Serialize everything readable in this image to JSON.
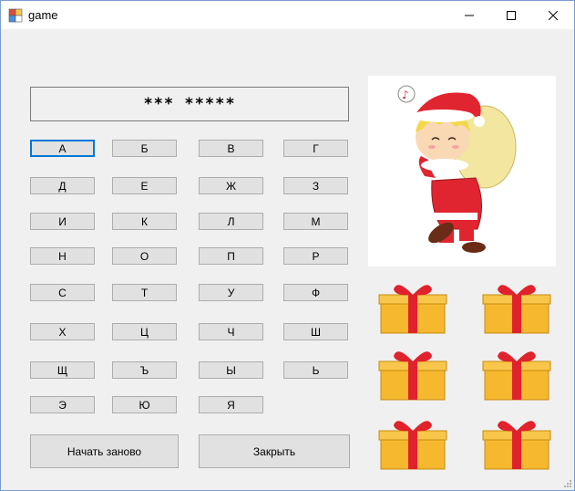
{
  "window": {
    "title": "game"
  },
  "display": {
    "masked_word": "*** *****"
  },
  "keyboard": {
    "keys": [
      "А",
      "Б",
      "В",
      "Г",
      "Д",
      "Е",
      "Ж",
      "З",
      "И",
      "К",
      "Л",
      "М",
      "Н",
      "О",
      "П",
      "Р",
      "С",
      "Т",
      "У",
      "Ф",
      "Х",
      "Ц",
      "Ч",
      "Ш",
      "Щ",
      "Ъ",
      "Ы",
      "Ь",
      "Э",
      "Ю",
      "Я"
    ]
  },
  "actions": {
    "restart_label": "Начать заново",
    "close_label": "Закрыть"
  },
  "picture": {
    "content": "santa-boy-with-sack"
  },
  "gifts": {
    "count": 6,
    "icon": "gift-box-icon"
  },
  "colors": {
    "accent": "#0078d7",
    "button_bg": "#e1e1e1",
    "window_bg": "#f0f0f0",
    "gift_box": "#f5b82e",
    "gift_ribbon": "#e0222c"
  }
}
